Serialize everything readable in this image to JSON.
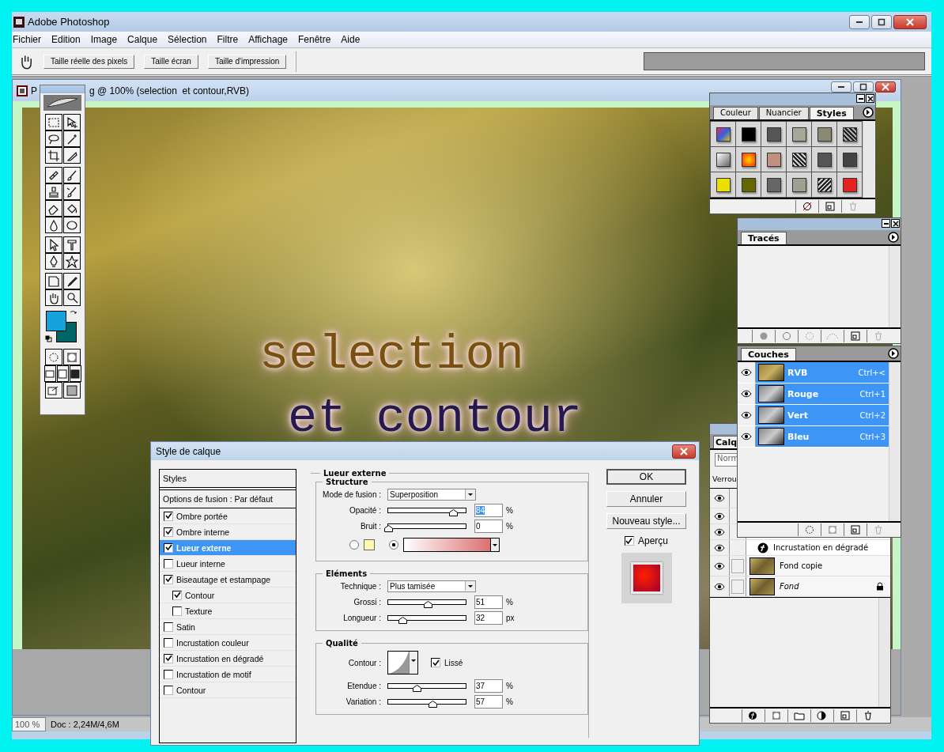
{
  "app": {
    "title": "Adobe Photoshop"
  },
  "menu": [
    "Fichier",
    "Edition",
    "Image",
    "Calque",
    "Sélection",
    "Filtre",
    "Affichage",
    "Fenêtre",
    "Aide"
  ],
  "options_bar": {
    "buttons": [
      "Taille réelle des pixels",
      "Taille écran",
      "Taille d'impression"
    ]
  },
  "document": {
    "title_parts": [
      "P",
      "g @ 100% (selection  et contour,RVB)"
    ],
    "artwork_lines": [
      "selection",
      "et contour"
    ]
  },
  "status_bar": {
    "zoom": "100 %",
    "doc_info": "Doc : 2,24M/4,6M"
  },
  "styles_panel": {
    "tabs": [
      {
        "label": "Couleur",
        "selected": false
      },
      {
        "label": "Nuancier",
        "selected": false
      },
      {
        "label": "Styles",
        "selected": true
      }
    ]
  },
  "paths_panel": {
    "tabs": [
      {
        "label": "Tracés",
        "selected": true
      }
    ]
  },
  "channels_panel": {
    "tabs": [
      {
        "label": "Couches",
        "selected": true
      }
    ],
    "channels": [
      {
        "name": "RVB",
        "shortcut": "Ctrl+<",
        "visible": true,
        "selected": true
      },
      {
        "name": "Rouge",
        "shortcut": "Ctrl+1",
        "visible": true,
        "selected": true
      },
      {
        "name": "Vert",
        "shortcut": "Ctrl+2",
        "visible": true,
        "selected": true
      },
      {
        "name": "Bleu",
        "shortcut": "Ctrl+3",
        "visible": true,
        "selected": true
      }
    ]
  },
  "layers_panel": {
    "tab": "Calq",
    "blend_mode": "Norm",
    "lock_label": "Verrou",
    "rows": [
      {
        "kind": "text",
        "visible": true
      },
      {
        "kind": "effect",
        "visible": true
      },
      {
        "kind": "effect",
        "visible": true
      },
      {
        "kind": "effect",
        "visible": true,
        "name": "Incrustation en dégradé"
      },
      {
        "kind": "layer",
        "name": "Fond copie",
        "visible": true,
        "locked": false
      },
      {
        "kind": "background",
        "name": "Fond",
        "visible": true,
        "locked": true
      }
    ]
  },
  "dialog": {
    "title": "Style de calque",
    "styles_header": "Styles",
    "blend_options": "Options de fusion : Par défaut",
    "effects": [
      {
        "label": "Ombre portée",
        "checked": true,
        "selected": false
      },
      {
        "label": "Ombre interne",
        "checked": true,
        "selected": false
      },
      {
        "label": "Lueur externe",
        "checked": true,
        "selected": true
      },
      {
        "label": "Lueur interne",
        "checked": false,
        "selected": false
      },
      {
        "label": "Biseautage et estampage",
        "checked": true,
        "selected": false,
        "children": [
          {
            "label": "Contour",
            "checked": true,
            "selected": false
          },
          {
            "label": "Texture",
            "checked": false,
            "selected": false
          }
        ]
      },
      {
        "label": "Satin",
        "checked": false,
        "selected": false
      },
      {
        "label": "Incrustation couleur",
        "checked": false,
        "selected": false
      },
      {
        "label": "Incrustation en dégradé",
        "checked": true,
        "selected": false
      },
      {
        "label": "Incrustation de motif",
        "checked": false,
        "selected": false
      },
      {
        "label": "Contour",
        "checked": false,
        "selected": false
      }
    ],
    "section_title": "Lueur externe",
    "groups": [
      {
        "title": "Structure",
        "rows": [
          {
            "kind": "select",
            "label": "Mode de fusion :",
            "value": "Superposition"
          },
          {
            "kind": "slider",
            "label": "Opacité :",
            "level": 0.84,
            "value": "84",
            "unit": "%",
            "selected": true
          },
          {
            "kind": "slider",
            "label": "Bruit :",
            "level": 0,
            "value": "0",
            "unit": "%",
            "selected": false
          },
          {
            "kind": "color_choice",
            "options": [
              {
                "kind": "solid",
                "selected": false
              },
              {
                "kind": "gradient",
                "selected": true
              }
            ]
          }
        ]
      },
      {
        "title": "Eléments",
        "rows": [
          {
            "kind": "select",
            "label": "Technique :",
            "value": "Plus tamisée"
          },
          {
            "kind": "slider",
            "label": "Grossi :",
            "level": 0.51,
            "value": "51",
            "unit": "%",
            "selected": false
          },
          {
            "kind": "slider",
            "label": "Longueur :",
            "level": 0.18,
            "value": "32",
            "unit": "px",
            "selected": false
          }
        ]
      },
      {
        "title": "Qualité",
        "rows": [
          {
            "kind": "contour",
            "label": "Contour :",
            "check_label": "Lissé",
            "checked": true
          },
          {
            "kind": "slider",
            "label": "Etendue :",
            "level": 0.37,
            "value": "37",
            "unit": "%",
            "selected": false
          },
          {
            "kind": "slider",
            "label": "Variation :",
            "level": 0.57,
            "value": "57",
            "unit": "%",
            "selected": false
          }
        ]
      }
    ],
    "buttons": [
      "OK",
      "Annuler",
      "Nouveau style..."
    ],
    "preview": {
      "label": "Aperçu",
      "checked": true
    }
  }
}
